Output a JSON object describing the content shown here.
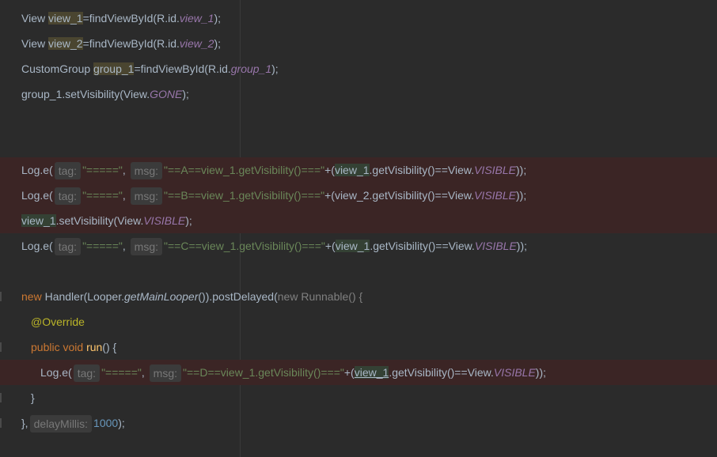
{
  "code_lines": [
    {
      "view1_decl": {
        "type": "View",
        "var": "view_1",
        "eq": "=findViewById(R.id.",
        "id": "view_1",
        "end": ");"
      }
    },
    {
      "view2_decl": {
        "type": "View",
        "var": "view_2",
        "eq": "=findViewById(R.id.",
        "id": "view_2",
        "end": ");"
      }
    },
    {
      "group_decl": {
        "type": "CustomGroup",
        "var": "group_1",
        "eq": "=findViewById(R.id.",
        "id": "group_1",
        "end": ");"
      }
    }
  ],
  "group_line": {
    "pre": "group_1.setVisibility(View.",
    "const": "GONE",
    "end": ");"
  },
  "hints": {
    "tag": "tag:",
    "msg": "msg:",
    "delay": "delayMillis:"
  },
  "log_a": {
    "call": "Log.e(",
    "tag_str": "\"=====\"",
    "comma": ",",
    "msg_str": "\"==A==view_1.getVisibility()===\"",
    "plus": "+(",
    "var": "view_1",
    "rest": ".getVisibility()==View.",
    "const": "VISIBLE",
    "end": "));"
  },
  "log_b": {
    "call": "Log.e(",
    "tag_str": "\"=====\"",
    "comma": ",",
    "msg_str": "\"==B==view_1.getVisibility()===\"",
    "plus": "+(",
    "var": "view_2",
    "rest": ".getVisibility()==View.",
    "const": "VISIBLE",
    "end": "));"
  },
  "set_visible": {
    "var": "view_1",
    "rest": ".setVisibility(View.",
    "const": "VISIBLE",
    "end": ");"
  },
  "log_c": {
    "call": "Log.e(",
    "tag_str": "\"=====\"",
    "comma": ",",
    "msg_str": "\"==C==view_1.getVisibility()===\"",
    "plus": "+(",
    "var": "view_1",
    "rest": ".getVisibility()==View.",
    "const": "VISIBLE",
    "end": "));"
  },
  "handler": {
    "kw_new": "new",
    "cls": " Handler(Looper.",
    "static_m": "getMainLooper",
    "mid": "()).postDelayed(",
    "kw_new2": "new",
    "runnable": " Runnable() {"
  },
  "override": "@Override",
  "run_decl": {
    "kw_public": "public",
    "kw_void": "void",
    "name": "run",
    "end": "() {"
  },
  "log_d": {
    "call": "Log.e(",
    "tag_str": "\"=====\"",
    "comma": ",",
    "msg_str": "\"==D==view_1.getVisibility()===\"",
    "plus": "+(",
    "var": "view_1",
    "rest": ".getVisibility()==View.",
    "const": "VISIBLE",
    "end": "));"
  },
  "close_brace": "}",
  "close_runnable": {
    "brace": "},",
    "value": "1000",
    "end": ");"
  },
  "colors": {
    "background": "#2b2b2b",
    "keyword": "#cc7832",
    "string": "#6a8759",
    "field": "#9876aa",
    "number": "#6897bb",
    "annotation": "#bbb529",
    "error_line": "#3b2525"
  }
}
